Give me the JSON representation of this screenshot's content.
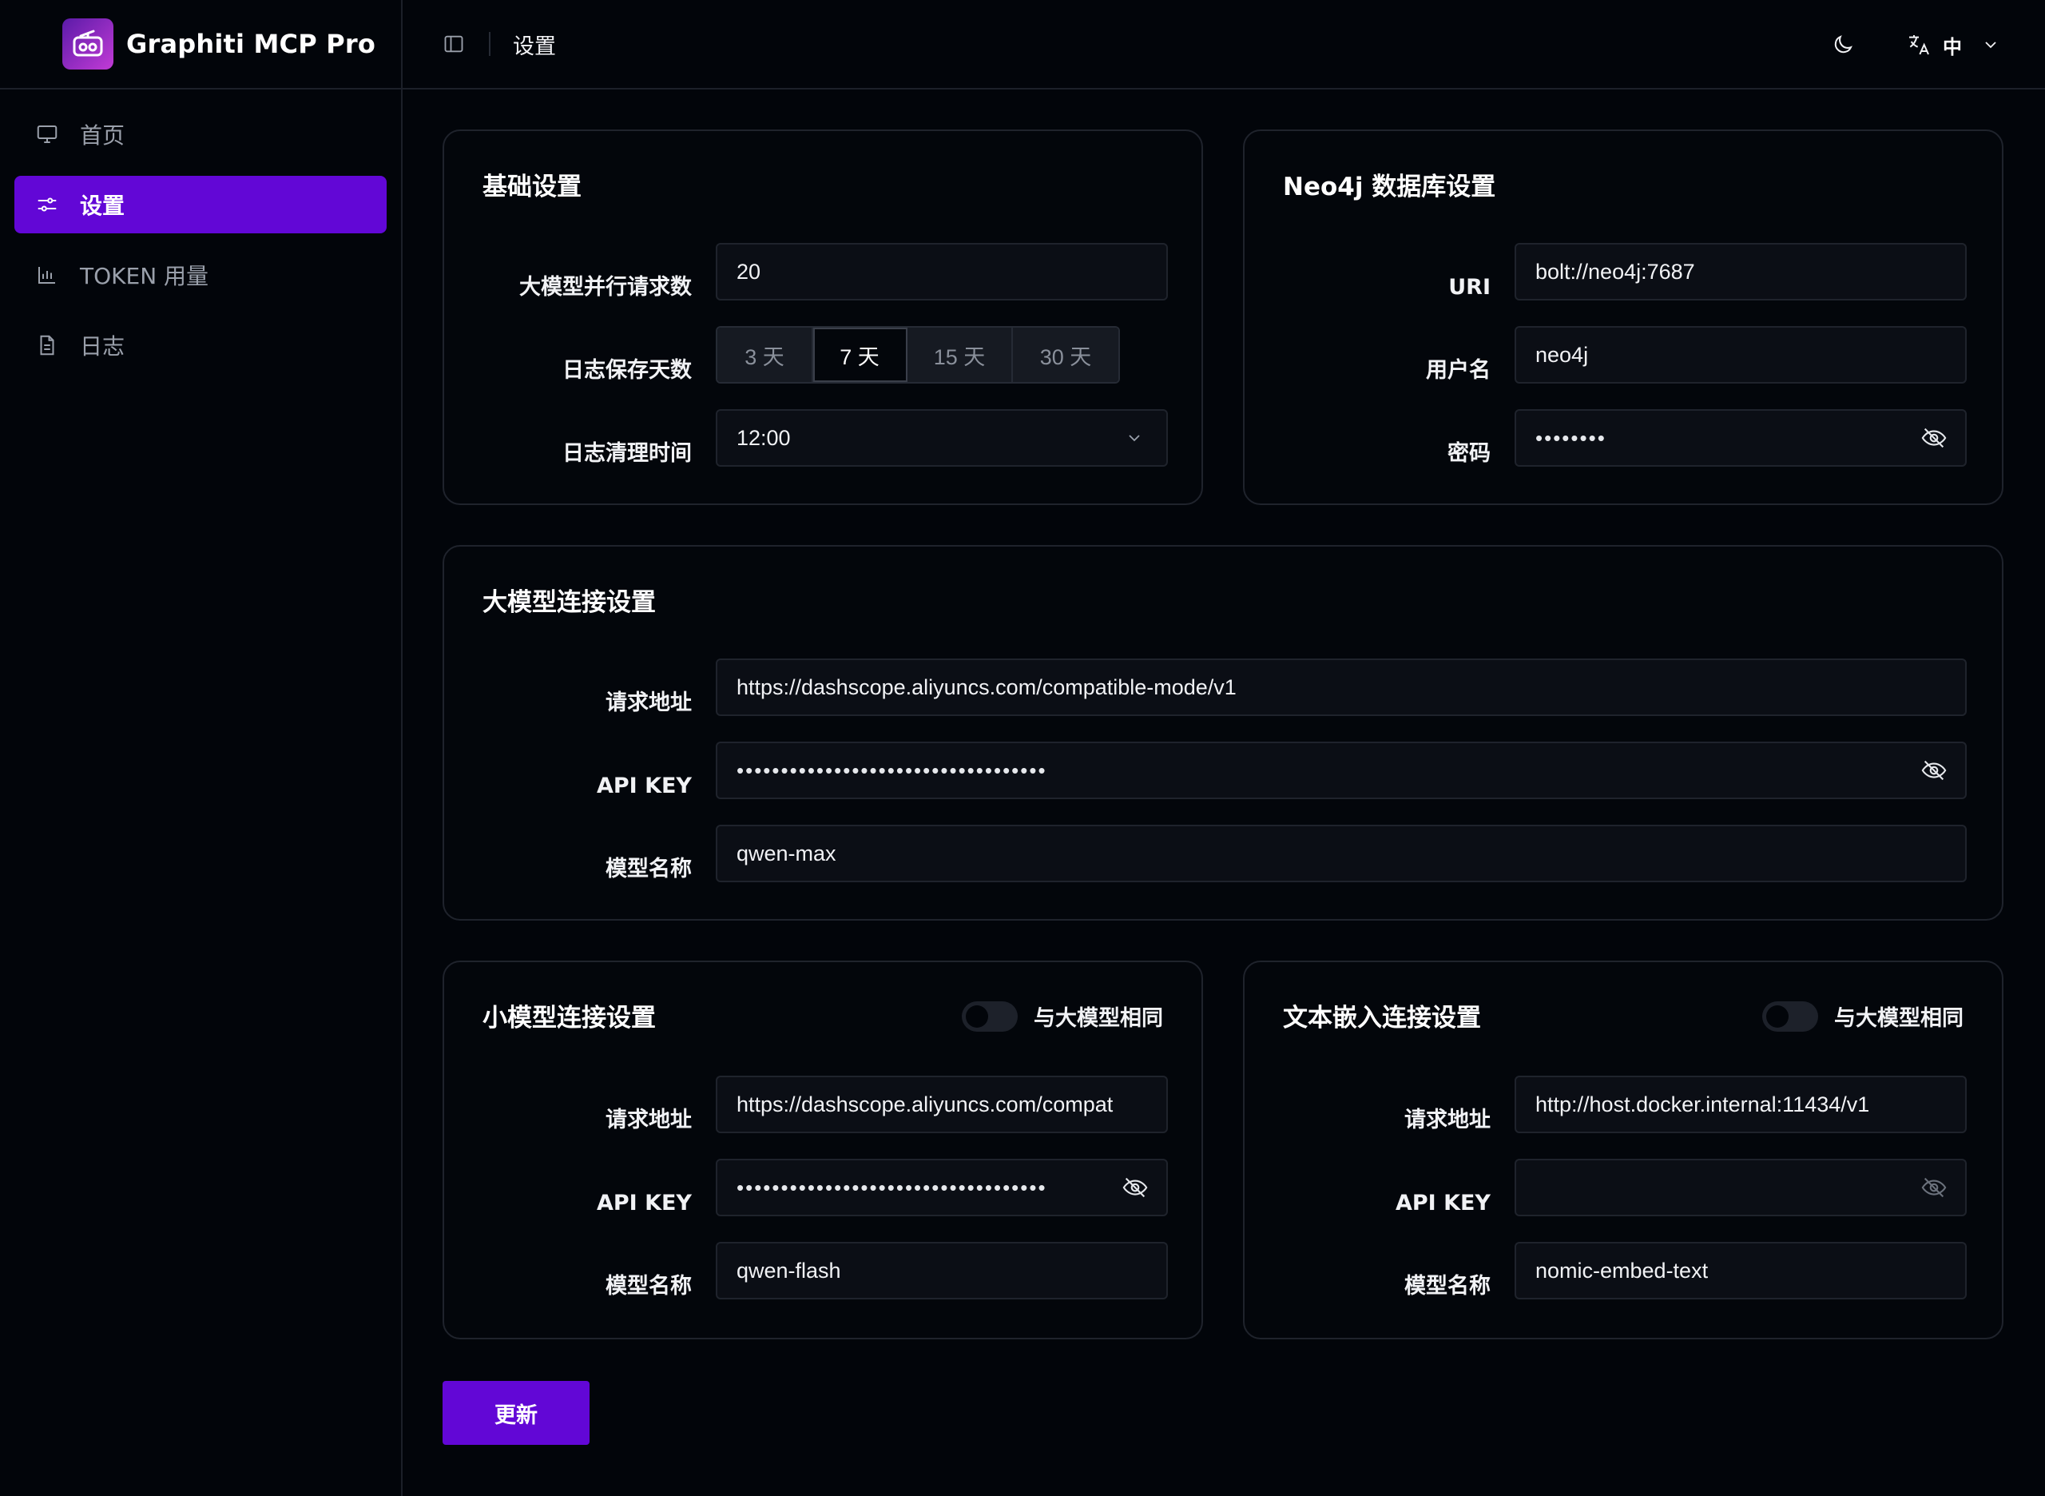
{
  "brand": {
    "name": "Graphiti MCP Pro"
  },
  "sidebar": {
    "items": [
      {
        "label": "首页",
        "icon": "monitor-icon"
      },
      {
        "label": "设置",
        "icon": "sliders-icon",
        "active": true
      },
      {
        "label": "TOKEN 用量",
        "icon": "bar-chart-icon"
      },
      {
        "label": "日志",
        "icon": "document-icon"
      }
    ]
  },
  "header": {
    "title": "设置",
    "language": "中"
  },
  "basic": {
    "title": "基础设置",
    "concurrency_label": "大模型并行请求数",
    "concurrency_value": "20",
    "retention_label": "日志保存天数",
    "retention_options": [
      "3 天",
      "7 天",
      "15 天",
      "30 天"
    ],
    "retention_selected": "7 天",
    "cleanup_label": "日志清理时间",
    "cleanup_value": "12:00"
  },
  "neo4j": {
    "title": "Neo4j 数据库设置",
    "uri_label": "URI",
    "uri_value": "bolt://neo4j:7687",
    "user_label": "用户名",
    "user_value": "neo4j",
    "password_label": "密码",
    "password_mask": "••••••••"
  },
  "llm": {
    "title": "大模型连接设置",
    "url_label": "请求地址",
    "url_value": "https://dashscope.aliyuncs.com/compatible-mode/v1",
    "key_label": "API KEY",
    "key_mask": "•••••••••••••••••••••••••••••••••••",
    "model_label": "模型名称",
    "model_value": "qwen-max"
  },
  "small_llm": {
    "title": "小模型连接设置",
    "same_label": "与大模型相同",
    "url_label": "请求地址",
    "url_value": "https://dashscope.aliyuncs.com/compat",
    "key_label": "API KEY",
    "key_mask": "•••••••••••••••••••••••••••••••••••",
    "model_label": "模型名称",
    "model_value": "qwen-flash"
  },
  "embedding": {
    "title": "文本嵌入连接设置",
    "same_label": "与大模型相同",
    "url_label": "请求地址",
    "url_value": "http://host.docker.internal:11434/v1",
    "key_label": "API KEY",
    "key_mask": "",
    "model_label": "模型名称",
    "model_value": "nomic-embed-text"
  },
  "actions": {
    "update_label": "更新"
  }
}
